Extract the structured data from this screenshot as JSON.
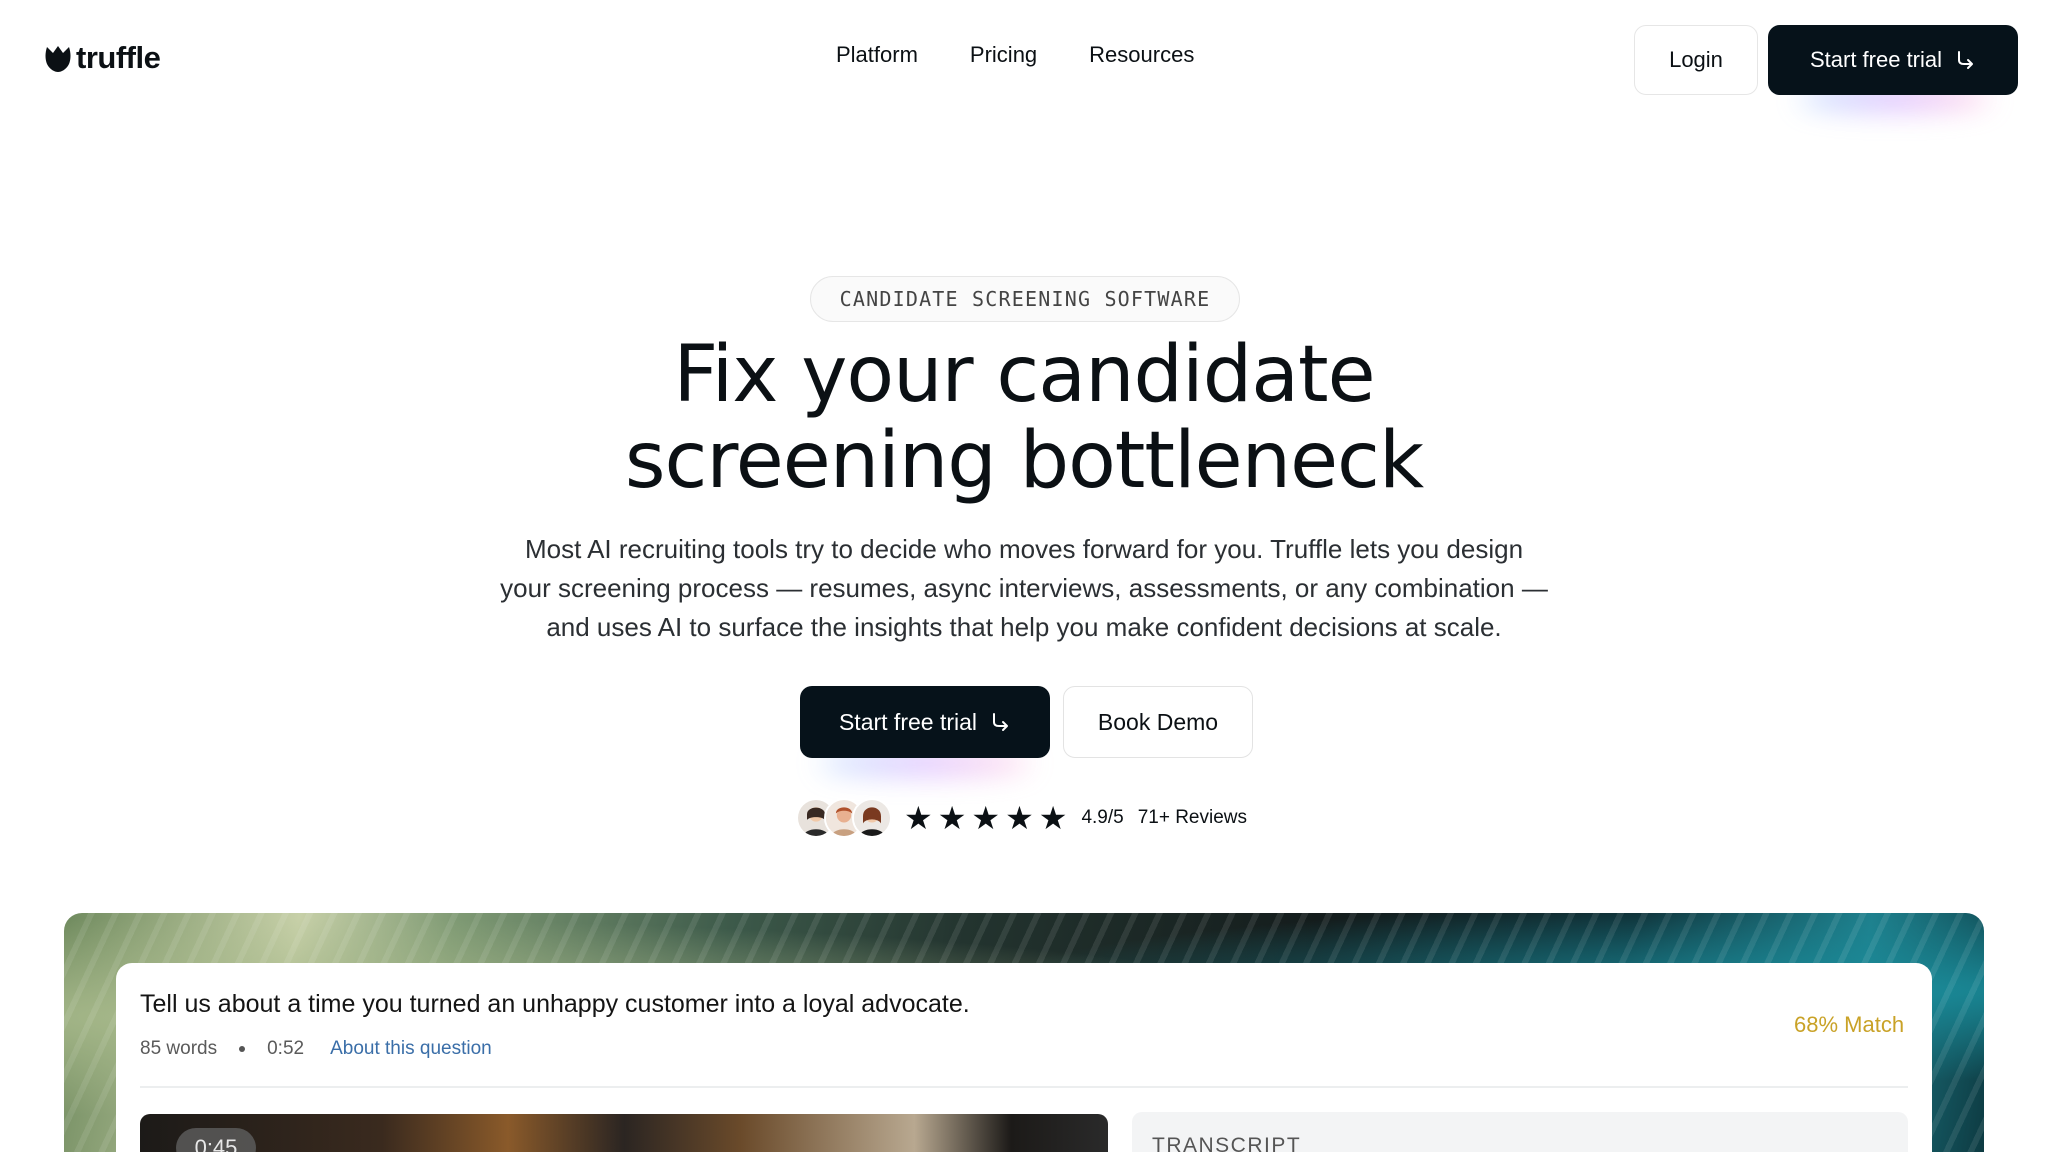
{
  "nav": {
    "logo_text": "truffle",
    "links": [
      "Platform",
      "Pricing",
      "Resources"
    ],
    "login_label": "Login",
    "trial_label": "Start free trial"
  },
  "hero": {
    "eyebrow": "CANDIDATE SCREENING SOFTWARE",
    "headline_line1": "Fix your candidate",
    "headline_line2": "screening bottleneck",
    "subtext_line1": "Most AI recruiting tools try to decide who moves forward for you. Truffle lets you design",
    "subtext_line2": "your screening process — resumes, async interviews, assessments, or any combination —",
    "subtext_line3": "and uses AI to surface the insights that help you make confident decisions at scale.",
    "primary_cta": "Start free trial",
    "secondary_cta": "Book Demo"
  },
  "social_proof": {
    "stars": 5,
    "rating": "4.9/5",
    "reviews": "71+ Reviews"
  },
  "preview": {
    "question": "Tell us about a time you turned an unhappy customer into a loyal advocate.",
    "word_count": "85 words",
    "duration": "0:52",
    "about_link": "About this question",
    "match": "68% Match",
    "timer": "0:45",
    "transcript_label": "TRANSCRIPT"
  },
  "colors": {
    "dark_button": "#06121a",
    "match_accent": "#c9a227",
    "link": "#3a6ea8"
  }
}
